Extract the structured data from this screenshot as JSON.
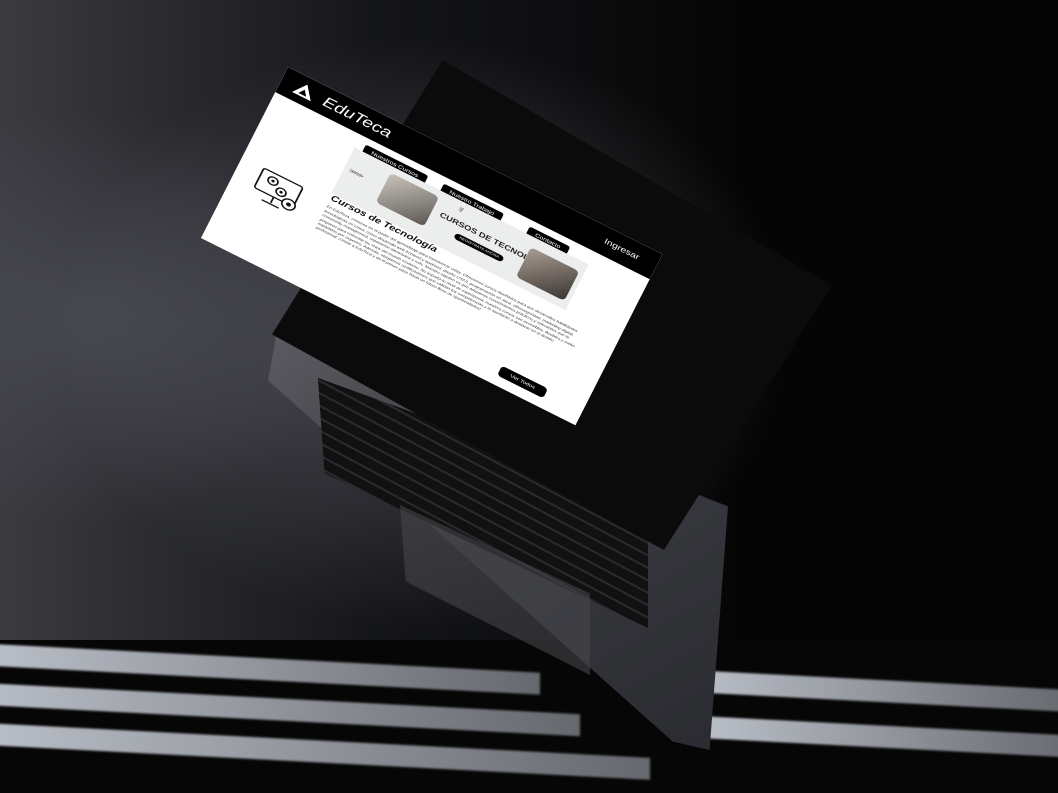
{
  "site": {
    "brand": "EduTeca",
    "nav": {
      "courses": "Nuestros Cursos",
      "work": "Nuestro Trabajo",
      "contact": "Contacto",
      "login": "Ingresar"
    },
    "hero": {
      "title": "CURSOS DE TECNOLOGÍA",
      "button": "REGISTRATE AHORA"
    },
    "course": {
      "title": "Cursos de Tecnología",
      "description": "En EduTeca, creemos en el poder del aprendizaje para transformar vidas. Ofrecemos cursos diseñados para que desarrolles habilidades tecnológicas en Linux, como desarrollo web frontend y backend, diseño UX/UI, programación en Java, ciberseguridad, marketing digital, community management, reparación electrónica y más. Nuestro objetivo es que adquieras conocimientos prácticos y relevantes que te preparen para enfrentar los retos del mundo moderno. No importa tu nivel de experiencia, nuestros cursos son accesibles, flexibles y están impartidos por expertos. Además, otorgamos certificaciones que validan tus competencias y te ayudarán a destacar en el ámbito profesional. ¡Únete a EduTeca y da el primer paso hacia un futuro lleno de oportunidades!",
      "button": "Ver Todos"
    }
  },
  "colors": {
    "nav_bg": "#000000",
    "page_bg": "#ffffff",
    "hero_bg": "#eceded",
    "button_bg": "#000000"
  }
}
